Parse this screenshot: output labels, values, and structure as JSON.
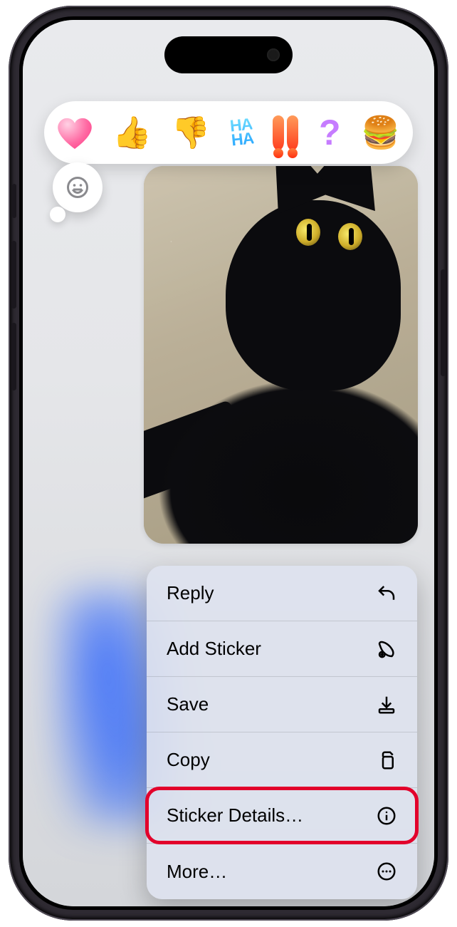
{
  "tapbacks": {
    "heart": "heart",
    "thumbs_up": "👍",
    "thumbs_down": "👎",
    "haha_top": "HA",
    "haha_bot": "HA",
    "exclaim": "!!",
    "question": "?",
    "sticker": "🍔"
  },
  "menu": {
    "reply": "Reply",
    "add_sticker": "Add Sticker",
    "save": "Save",
    "copy": "Copy",
    "sticker_details": "Sticker Details…",
    "more": "More…"
  }
}
